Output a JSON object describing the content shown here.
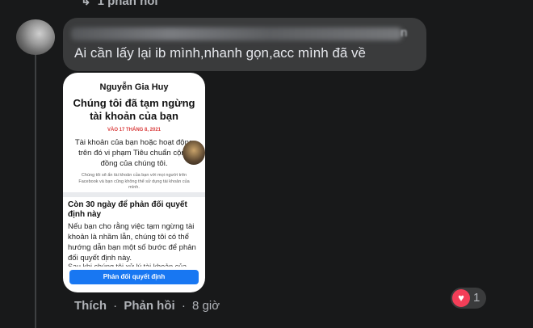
{
  "top": {
    "reply_count_label": "1 phản hồi",
    "arrow_icon": "reply-arrow-icon"
  },
  "comment": {
    "author_tail": "n",
    "text": "Ai cần lấy lại ib mình,nhanh gọn,acc mình đã về"
  },
  "attachment": {
    "account_name": "Nguyễn Gia Huy",
    "headline": "Chúng tôi đã tạm ngừng tài khoản của bạn",
    "date": "VÀO 17 THÁNG 8, 2021",
    "description": "Tài khoản của bạn hoặc hoạt động trên đó vi phạm Tiêu chuẩn cộng đồng của chúng tôi.",
    "small_note": "Chúng tôi sẽ ẩn tài khoản của bạn với mọi người trên Facebook và bạn cũng không thể sử dụng tài khoản của mình.",
    "appeal_title": "Còn 30 ngày để phản đối quyết định này",
    "appeal_body": "Nếu bạn cho rằng việc tạm ngừng tài khoản là nhầm lẫn, chúng tôi có thể hướng dẫn bạn một số bước để phản đối quyết định này.",
    "cutoff_text": "Sau khi chúng tôi xử lý tài khoản của",
    "appeal_button": "Phản đối quyết định"
  },
  "actions": {
    "like": "Thích",
    "reply": "Phản hồi",
    "separator": "·",
    "time": "8 giờ"
  },
  "reaction": {
    "icon": "heart-icon",
    "count": "1",
    "color": "#f33e58"
  }
}
